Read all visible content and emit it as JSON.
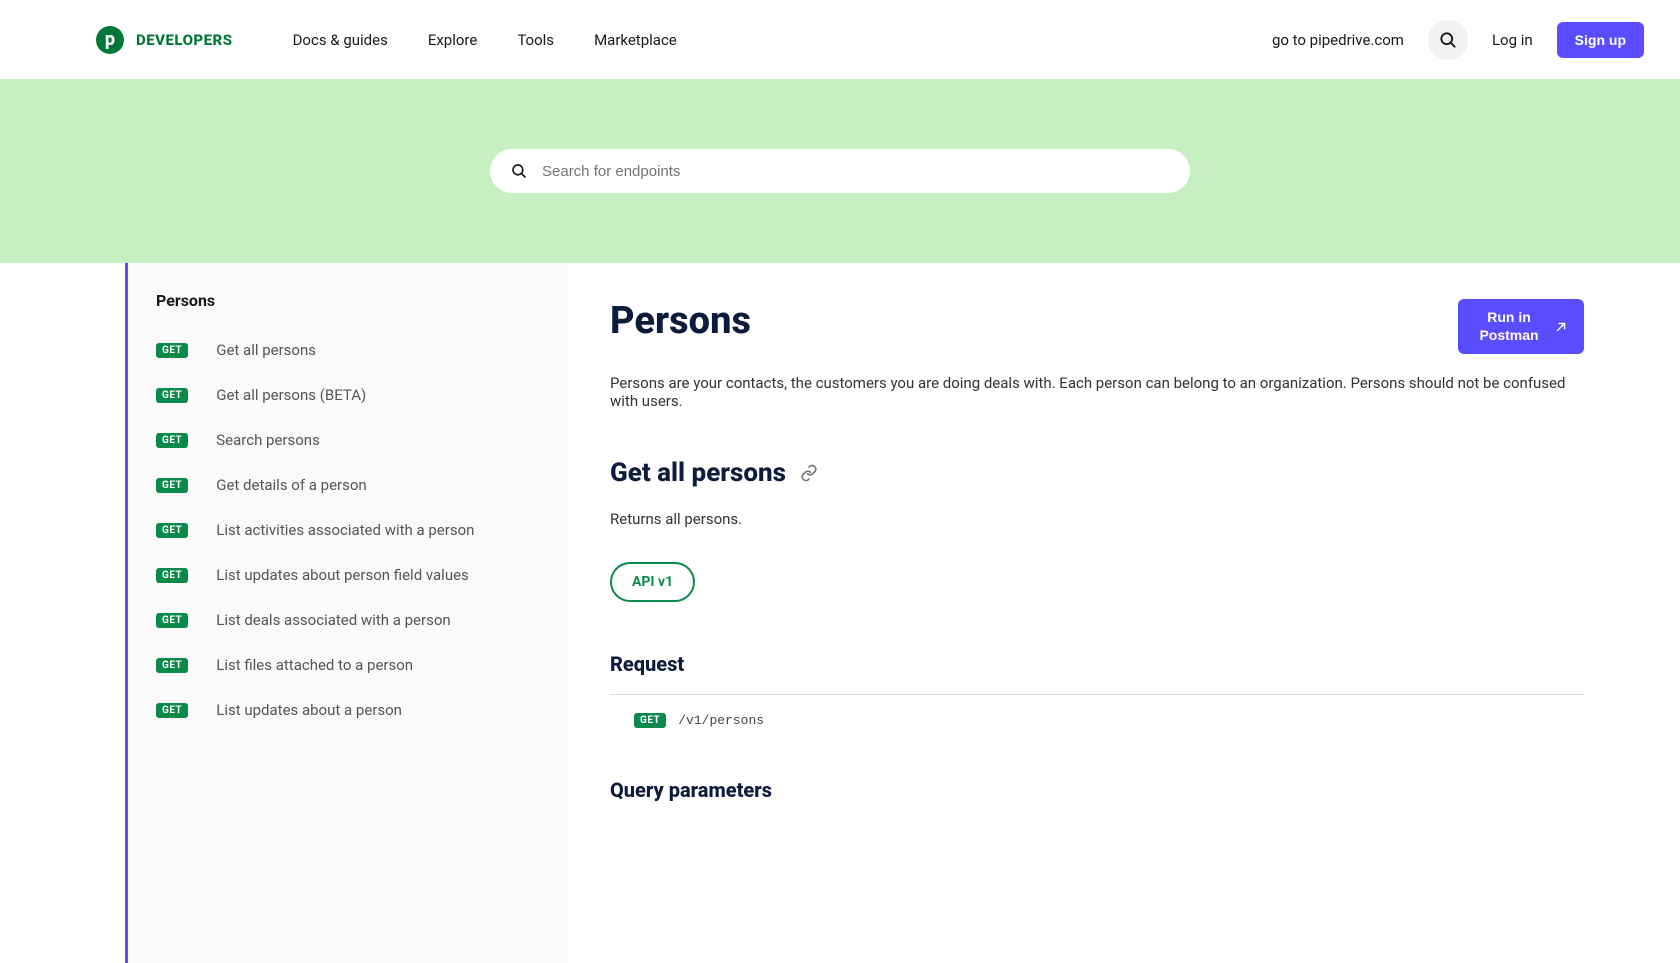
{
  "brand": {
    "logo_letter": "p",
    "text": "DEVELOPERS"
  },
  "nav": {
    "items": [
      "Docs & guides",
      "Explore",
      "Tools",
      "Marketplace"
    ],
    "goto": "go to pipedrive.com",
    "login": "Log in",
    "signup": "Sign up"
  },
  "hero": {
    "placeholder": "Search for endpoints"
  },
  "sidebar": {
    "group": "Persons",
    "items": [
      {
        "method": "GET",
        "label": "Get all persons"
      },
      {
        "method": "GET",
        "label": "Get all persons (BETA)"
      },
      {
        "method": "GET",
        "label": "Search persons"
      },
      {
        "method": "GET",
        "label": "Get details of a person"
      },
      {
        "method": "GET",
        "label": "List activities associated with a person"
      },
      {
        "method": "GET",
        "label": "List updates about person field values"
      },
      {
        "method": "GET",
        "label": "List deals associated with a person"
      },
      {
        "method": "GET",
        "label": "List files attached to a person"
      },
      {
        "method": "GET",
        "label": "List updates about a person"
      }
    ]
  },
  "main": {
    "title": "Persons",
    "postman_label": "Run in Postman",
    "desc": "Persons are your contacts, the customers you are doing deals with. Each person can belong to an organization. Persons should not be confused with users.",
    "section_title": "Get all persons",
    "section_desc": "Returns all persons.",
    "api_pill": "API v1",
    "request_head": "Request",
    "request_method": "GET",
    "request_path": "/v1/persons",
    "query_head": "Query parameters"
  }
}
